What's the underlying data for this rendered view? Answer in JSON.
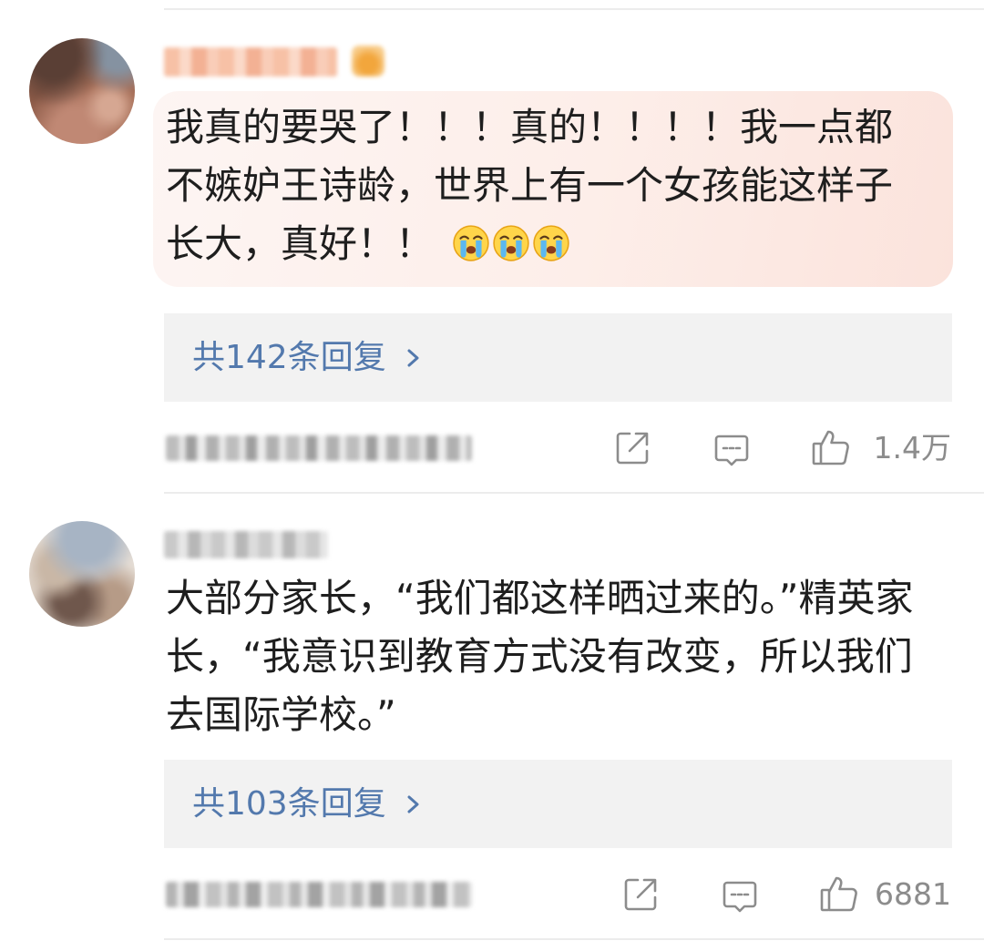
{
  "comments": [
    {
      "lines": [
        "我真的要哭了！！！真的！！！！我一点都",
        "不嫉妒王诗龄，世界上有一个女孩能这样子",
        "长大，真好！！"
      ],
      "emoji": [
        "crying-face",
        "crying-face",
        "crying-face"
      ],
      "replies_label": "共142条回复",
      "like_count": "1.4万"
    },
    {
      "lines": [
        "大部分家长，“我们都这样晒过来的。”精英家",
        "长，“我意识到教育方式没有改变，所以我们",
        "去国际学校。”"
      ],
      "replies_label": "共103条回复",
      "like_count": "6881"
    }
  ],
  "icons": {
    "share": "share-icon",
    "comment": "comment-icon",
    "like": "thumbs-up-icon",
    "more_replies": "chevron-right-icon",
    "emoji": "crying-face-emoji"
  },
  "colors": {
    "text": "#1e1e1e",
    "link": "#5379ad",
    "meta": "#8c8c8c",
    "reply_box_bg": "#f2f2f2",
    "highlight_bg": "#fdeee9",
    "divider": "#ececec"
  }
}
